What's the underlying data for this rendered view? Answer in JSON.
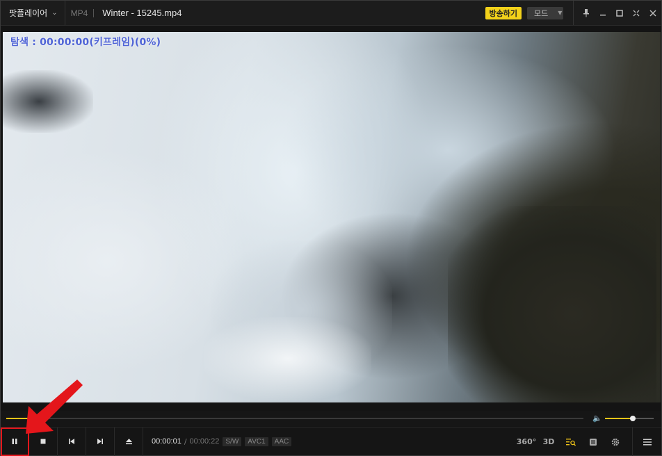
{
  "titlebar": {
    "app_name": "팟플레이어",
    "format": "MP4",
    "file_title": "Winter - 15245.mp4",
    "broadcast_label": "방송하기",
    "mode_label": "모드"
  },
  "video": {
    "seek_status": "탐색 : 00:00:00(키프레임)(0%)"
  },
  "seekbar": {
    "progress": 0.04,
    "volume": 0.57
  },
  "controls": {
    "time_current": "00:00:01",
    "time_total": "00:00:22",
    "badges": [
      "S/W",
      "AVC1",
      "AAC"
    ],
    "right_icons": {
      "vr360": "360°",
      "three_d": "3D"
    }
  },
  "colors": {
    "accent": "#f0c419",
    "seek_text": "#4e63d6",
    "annotation": "#e4161b"
  }
}
